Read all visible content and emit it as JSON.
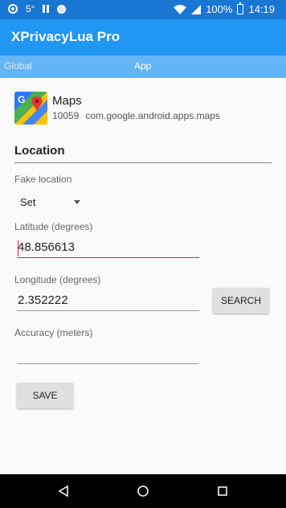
{
  "status_bar": {
    "temperature": "5°",
    "battery": "100%",
    "time": "14:19"
  },
  "app_bar": {
    "title": "XPrivacyLua Pro"
  },
  "tabs": [
    {
      "label": "Global",
      "selected": false
    },
    {
      "label": "App",
      "selected": true
    }
  ],
  "app": {
    "name": "Maps",
    "uid": "10059",
    "package": "com.google.android.apps.maps"
  },
  "location": {
    "section_title": "Location",
    "fake_location_label": "Fake location",
    "fake_location_value": "Set",
    "latitude_label": "Latitude (degrees)",
    "latitude_value": "48.856613",
    "longitude_label": "Longitude (degrees)",
    "longitude_value": "2.352222",
    "search_button": "SEARCH",
    "accuracy_label": "Accuracy (meters)",
    "accuracy_value": "",
    "save_button": "SAVE"
  },
  "colors": {
    "status_bar": "#1976d2",
    "app_bar": "#2196f3",
    "tab_bar": "#64b5f6",
    "focus_accent": "#e91e63"
  }
}
